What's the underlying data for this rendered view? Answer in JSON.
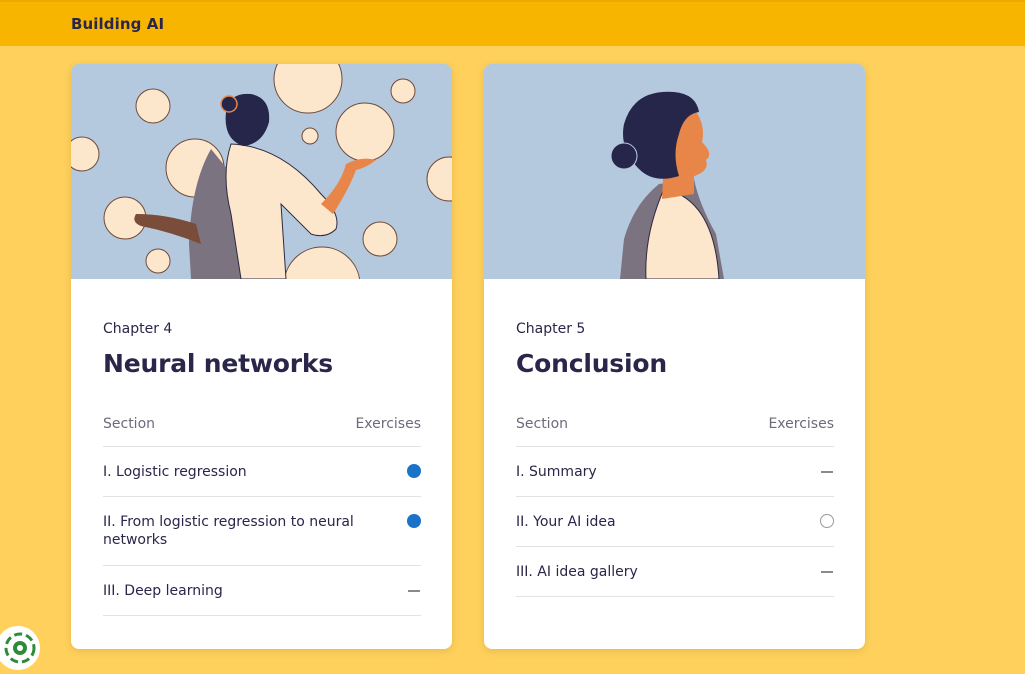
{
  "app": {
    "title": "Building AI"
  },
  "chapters": [
    {
      "label": "Chapter 4",
      "title": "Neural networks",
      "col_section": "Section",
      "col_exercises": "Exercises",
      "sections": [
        {
          "label": "I. Logistic regression",
          "status": "completed"
        },
        {
          "label": "II. From logistic regression to neural networks",
          "status": "completed"
        },
        {
          "label": "III. Deep learning",
          "status": "none"
        }
      ]
    },
    {
      "label": "Chapter 5",
      "title": "Conclusion",
      "col_section": "Section",
      "col_exercises": "Exercises",
      "sections": [
        {
          "label": "I. Summary",
          "status": "none"
        },
        {
          "label": "II. Your AI idea",
          "status": "not-started"
        },
        {
          "label": "III. AI idea gallery",
          "status": "none"
        }
      ]
    }
  ],
  "colors": {
    "background": "#FFD15C",
    "header": "#F8B500",
    "text": "#29264A",
    "completed": "#1A73C8"
  }
}
